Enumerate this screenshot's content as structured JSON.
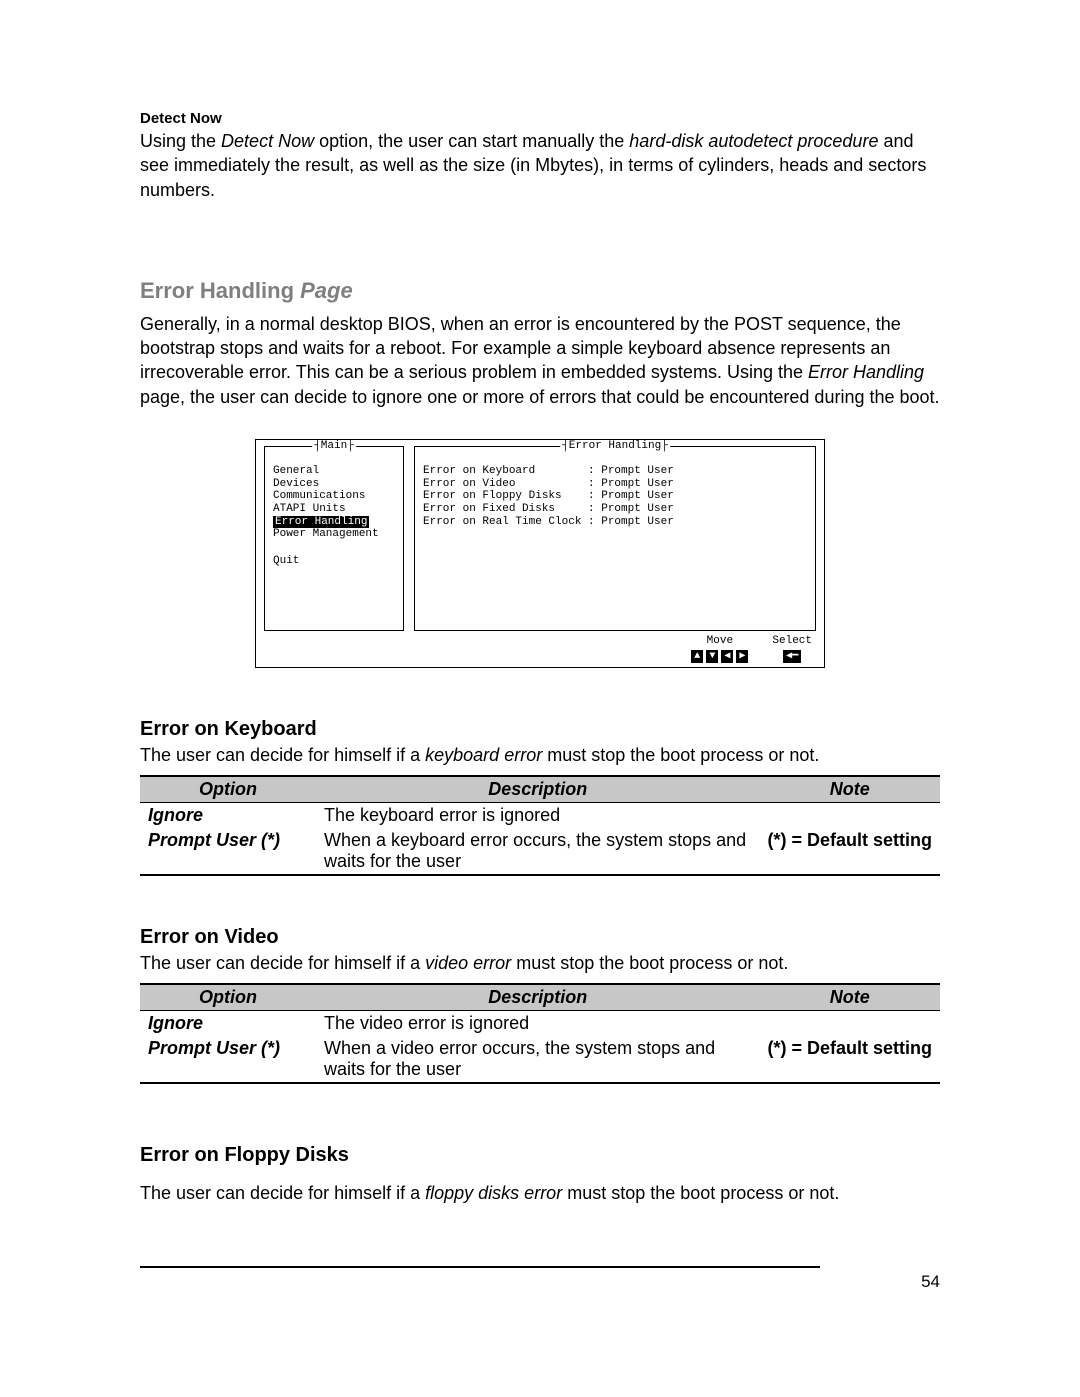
{
  "page_number": "54",
  "detect_now": {
    "heading": "Detect Now",
    "p_prefix": "Using the ",
    "p_em1": "Detect Now",
    "p_mid1": " option, the user can start manually the ",
    "p_em2": "hard-disk autodetect procedure",
    "p_suffix": " and see immediately the result, as well as the size (in Mbytes), in terms of cylinders, heads and sectors numbers."
  },
  "section": {
    "title_strong": "Error Handling ",
    "title_em": "Page",
    "p_prefix": "Generally, in a normal desktop BIOS, when an error is encountered by the POST sequence, the bootstrap stops and waits for a reboot. For example a simple keyboard absence represents an irrecoverable error. This can be a serious problem in embedded systems. Using the ",
    "p_em": "Error Handling",
    "p_suffix": " page, the user can decide to ignore one or more of errors that could be encountered during the boot."
  },
  "bios": {
    "left_title": "Main",
    "right_title": "Error Handling",
    "menu": [
      "General",
      "Devices",
      "Communications",
      "ATAPI Units",
      "Error Handling",
      "Power Management"
    ],
    "selected_index": 4,
    "quit": "Quit",
    "errors": [
      "Error on Keyboard        : Prompt User",
      "Error on Video           : Prompt User",
      "Error on Floppy Disks    : Prompt User",
      "Error on Fixed Disks     : Prompt User",
      "Error on Real Time Clock : Prompt User"
    ],
    "footer": {
      "move_label": "Move",
      "move_keys": [
        "▲",
        "▼",
        "◀",
        "▶"
      ],
      "select_label": "Select",
      "select_keys": [
        "◀━"
      ]
    }
  },
  "tables": {
    "headers": {
      "option": "Option",
      "description": "Description",
      "note": "Note"
    },
    "default_note": "(*) = Default setting"
  },
  "err_keyboard": {
    "heading": "Error on Keyboard",
    "intro_pre": "The user can decide for himself if a ",
    "intro_em": "keyboard error",
    "intro_post": " must stop the boot process or not.",
    "rows": [
      {
        "option": "Ignore",
        "desc": "The keyboard error is ignored",
        "note": ""
      },
      {
        "option": "Prompt User (*)",
        "desc": "When a keyboard error occurs, the system stops and waits for the user",
        "note": "(*) = Default setting"
      }
    ]
  },
  "err_video": {
    "heading": "Error on Video",
    "intro_pre": "The user can decide for himself if a ",
    "intro_em": "video error",
    "intro_post": " must stop the boot process or not.",
    "rows": [
      {
        "option": "Ignore",
        "desc": "The video error is ignored",
        "note": ""
      },
      {
        "option": "Prompt User (*)",
        "desc": "When a video error occurs, the system stops and waits for the user",
        "note": "(*) = Default setting"
      }
    ]
  },
  "err_floppy": {
    "heading": "Error on Floppy Disks",
    "intro_pre": "The user can decide for himself if a ",
    "intro_em": "floppy disks error",
    "intro_post": " must stop the boot process or not."
  }
}
